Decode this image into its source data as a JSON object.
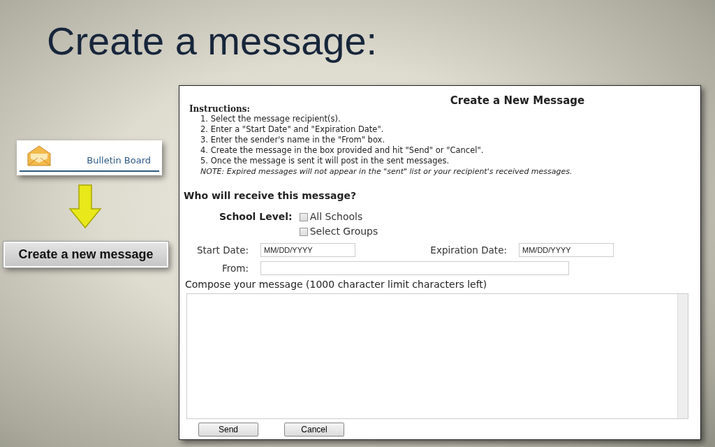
{
  "slide_title": "Create a message:",
  "bulletin_board": {
    "label": "Bulletin Board"
  },
  "create_button": {
    "label": "Create a new message"
  },
  "form": {
    "title": "Create a New Message",
    "instructions_heading": "Instructions:",
    "instructions": [
      "1. Select the message recipient(s).",
      "2. Enter a \"Start Date\" and \"Expiration Date\".",
      "3. Enter the sender's name in the \"From\" box.",
      "4. Create the message in the box provided and hit \"Send\" or \"Cancel\".",
      "5. Once the message is sent it will post in the sent messages."
    ],
    "note": "NOTE: Expired messages will not appear in the \"sent\" list or your recipient's received messages.",
    "recipients_heading": "Who will receive this message?",
    "school_level": {
      "label": "School Level:",
      "options": [
        {
          "label": "All Schools",
          "checked": false
        },
        {
          "label": "Select Groups",
          "checked": false
        }
      ]
    },
    "start_date": {
      "label": "Start Date:",
      "placeholder": "MM/DD/YYYY"
    },
    "expiration_date": {
      "label": "Expiration Date:",
      "placeholder": "MM/DD/YYYY"
    },
    "from": {
      "label": "From:"
    },
    "compose_label": "Compose your message (1000 character limit characters left)",
    "buttons": [
      "Send",
      "Cancel"
    ]
  }
}
